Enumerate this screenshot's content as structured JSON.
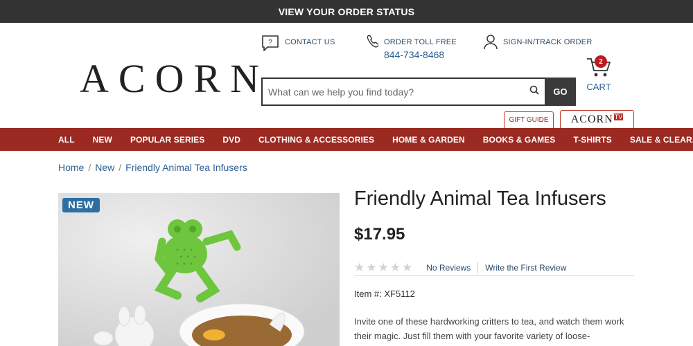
{
  "top_banner": {
    "text": "VIEW YOUR ORDER STATUS"
  },
  "logo": {
    "text": "ACORN"
  },
  "utility": {
    "contact": "CONTACT US",
    "order_toll_free": "ORDER TOLL FREE",
    "phone": "844-734-8468",
    "sign_in": "SIGN-IN/TRACK ORDER"
  },
  "search": {
    "placeholder": "What can we help you find today?",
    "go_label": "GO"
  },
  "cart": {
    "count": "2",
    "label": "CART"
  },
  "tabs": {
    "gift_guide": "GIFT GUIDE",
    "acorn_tv": "ACORN",
    "acorn_tv_badge": "TV"
  },
  "nav": {
    "items": [
      {
        "label": "ALL"
      },
      {
        "label": "NEW"
      },
      {
        "label": "POPULAR SERIES"
      },
      {
        "label": "DVD"
      },
      {
        "label": "CLOTHING & ACCESSORIES"
      },
      {
        "label": "HOME & GARDEN"
      },
      {
        "label": "BOOKS & GAMES"
      },
      {
        "label": "T-SHIRTS"
      },
      {
        "label": "SALE & CLEARANCE"
      }
    ]
  },
  "breadcrumb": {
    "home": "Home",
    "new": "New",
    "current": "Friendly Animal Tea Infusers",
    "separator": "/"
  },
  "product": {
    "badge": "NEW",
    "title": "Friendly Animal Tea Infusers",
    "price": "$17.95",
    "stars": "★★★★★",
    "no_reviews": "No Reviews",
    "write_review": "Write the First Review",
    "item_number": "Item #: XF5112",
    "description": "Invite one of these hardworking critters to tea, and watch them work their magic. Just fill them with your favorite variety of loose-"
  },
  "colors": {
    "nav_bg": "#9a2a22",
    "accent_blue": "#2b5f93",
    "badge_red": "#c0181f",
    "topbar_bg": "#333333"
  }
}
